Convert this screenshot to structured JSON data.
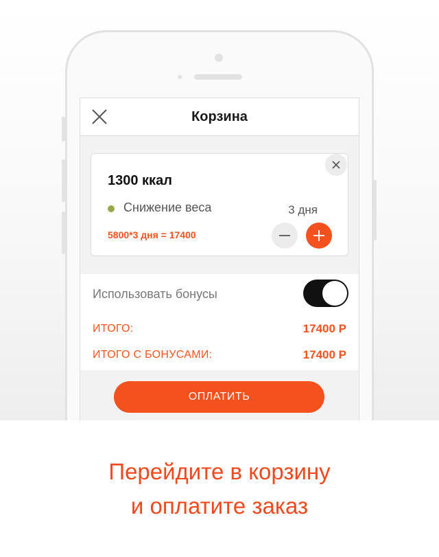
{
  "header": {
    "title": "Корзина"
  },
  "cart_item": {
    "calories": "1300 ккал",
    "goal": "Снижение веса",
    "goal_color": "#9aa84a",
    "days": "3 дня",
    "formula": "5800*3 дня = 17400"
  },
  "bonuses": {
    "label": "Использовать бонусы",
    "enabled": true
  },
  "totals": {
    "total_label": "ИТОГО:",
    "total_value": "17400 Р",
    "bonus_total_label": "ИТОГО С БОНУСАМИ:",
    "bonus_total_value": "17400 Р"
  },
  "pay_button": {
    "label": "ОПЛАТИТЬ"
  },
  "caption": {
    "line1": "Перейдите в корзину",
    "line2": "и оплатите заказ"
  },
  "colors": {
    "accent": "#f5511e",
    "text_accent": "#f0531f",
    "caption": "#ee4a1e"
  },
  "icons": [
    "close-icon",
    "remove-item-icon",
    "minus-icon",
    "plus-icon"
  ]
}
